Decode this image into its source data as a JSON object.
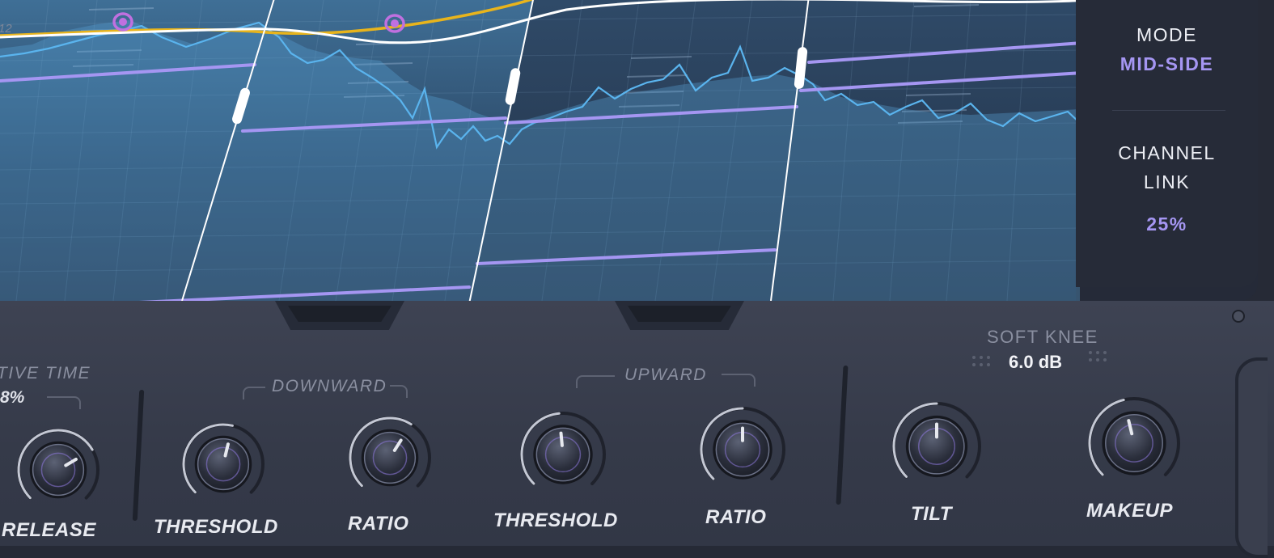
{
  "display": {
    "axis_tick": "12",
    "colors": {
      "spectrum": "#5ab4ee",
      "threshold": "#a596f2",
      "curve": "#ffffff",
      "tilt_curve": "#e8b41c",
      "node": "#c070e0"
    }
  },
  "side_panel": {
    "mode_label": "MODE",
    "mode_value": "MID-SIDE",
    "link_label_1": "CHANNEL",
    "link_label_2": "LINK",
    "link_value": "25%"
  },
  "controls": {
    "adaptive_time_label": "TIVE TIME",
    "adaptive_time_value": "8%",
    "downward_label": "DOWNWARD",
    "upward_label": "UPWARD",
    "soft_knee_label": "SOFT KNEE",
    "soft_knee_value": "6.0 dB",
    "knobs": {
      "release": "RELEASE",
      "down_threshold": "THRESHOLD",
      "down_ratio": "RATIO",
      "up_threshold": "THRESHOLD",
      "up_ratio": "RATIO",
      "tilt": "TILT",
      "makeup": "MAKEUP"
    },
    "knob_levels": {
      "release": 0.72,
      "down_threshold": 0.55,
      "down_ratio": 0.62,
      "up_threshold": 0.48,
      "up_ratio": 0.5,
      "tilt": 0.5,
      "makeup": 0.45
    }
  }
}
